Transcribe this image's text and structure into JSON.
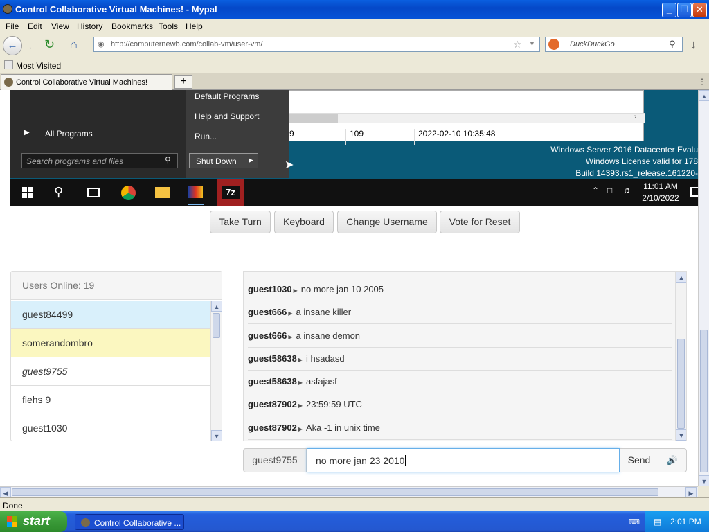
{
  "window": {
    "title": "Control Collaborative Virtual Machines! - Mypal",
    "buttons": [
      "_",
      "❐",
      "✕"
    ]
  },
  "menu": [
    "File",
    "Edit",
    "View",
    "History",
    "Bookmarks",
    "Tools",
    "Help"
  ],
  "nav": {
    "url": "http://computernewb.com/collab-vm/user-vm/",
    "search_placeholder": "DuckDuckGo"
  },
  "bookmarks": {
    "most_visited": "Most Visited"
  },
  "tab": {
    "label": "Control Collaborative Virtual Machines!",
    "new": "+"
  },
  "vm": {
    "startmenu": {
      "right_items": [
        "Default Programs",
        "Help and Support",
        "Run..."
      ],
      "all_programs": "All Programs",
      "search_placeholder": "Search programs and files",
      "shutdown": "Shut Down"
    },
    "table_row": {
      "col1": "9",
      "col2": "109",
      "col3": "2022-02-10 10:35:48"
    },
    "watermark": [
      "Windows Server 2016 Datacenter Evalu",
      "Windows License valid for 178",
      "Build 14393.rs1_release.161220-"
    ],
    "clock": {
      "time": "11:01 AM",
      "date": "2/10/2022"
    },
    "taskbar_7z": "7z"
  },
  "controls": {
    "take_turn": "Take Turn",
    "keyboard": "Keyboard",
    "change_username": "Change Username",
    "vote_reset": "Vote for Reset"
  },
  "users": {
    "header": "Users Online: 19",
    "list": [
      "guest84499",
      "somerandombro",
      "guest9755",
      "flehs 9",
      "guest1030"
    ]
  },
  "chat": {
    "messages": [
      {
        "user": "guest1030",
        "text": "no more jan 10 2005"
      },
      {
        "user": "guest666",
        "text": "a insane killer"
      },
      {
        "user": "guest666",
        "text": "a insane demon"
      },
      {
        "user": "guest58638",
        "text": "i hsadasd"
      },
      {
        "user": "guest58638",
        "text": "asfajasf"
      },
      {
        "user": "guest87902",
        "text": "23:59:59 UTC"
      },
      {
        "user": "guest87902",
        "text": "Aka -1 in unix time"
      }
    ],
    "username": "guest9755",
    "input_value": "no more jan 23 2010",
    "send": "Send"
  },
  "status": "Done",
  "taskbar": {
    "start": "start",
    "item": "Control Collaborative ...",
    "time": "2:01 PM"
  },
  "colors": {
    "xp_blue": "#0548c8",
    "start_green": "#3a9a38",
    "highlight_blue": "#d9f0fb",
    "highlight_yellow": "#fbf7c0"
  }
}
